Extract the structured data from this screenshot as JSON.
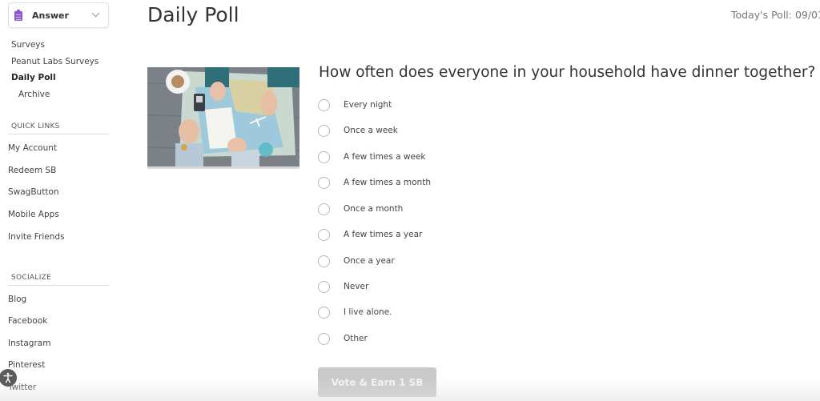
{
  "sidebar": {
    "dropdown": {
      "label": "Answer",
      "icon": "clipboard-icon",
      "icon_color": "#8a5bc9"
    },
    "nav": [
      {
        "label": "Surveys",
        "active": false
      },
      {
        "label": "Peanut Labs Surveys",
        "active": false
      },
      {
        "label": "Daily Poll",
        "active": true
      },
      {
        "label": "Archive",
        "active": false,
        "sub": true
      }
    ],
    "quick_links": {
      "heading": "QUICK LINKS",
      "items": [
        "My Account",
        "Redeem SB",
        "SwagButton",
        "Mobile Apps",
        "Invite Friends"
      ]
    },
    "socialize": {
      "heading": "SOCIALIZE",
      "items": [
        "Blog",
        "Facebook",
        "Instagram",
        "Pinterest",
        "Twitter"
      ]
    },
    "accessibility_icon": "accessibility-icon"
  },
  "main": {
    "title": "Daily Poll",
    "poll_date": "Today's Poll: 09/01",
    "image_description": "Overhead photo of hands planning a trip over a map with coffee, camera and notebook",
    "question": "How often does everyone in your household have dinner together?",
    "options": [
      "Every night",
      "Once a week",
      "A few times a week",
      "A few times a month",
      "Once a month",
      "A few times a year",
      "Once a year",
      "Never",
      "I live alone.",
      "Other"
    ],
    "vote_button": {
      "label": "Vote & Earn 1 SB",
      "enabled": false,
      "color": "#c9c9c9"
    }
  }
}
